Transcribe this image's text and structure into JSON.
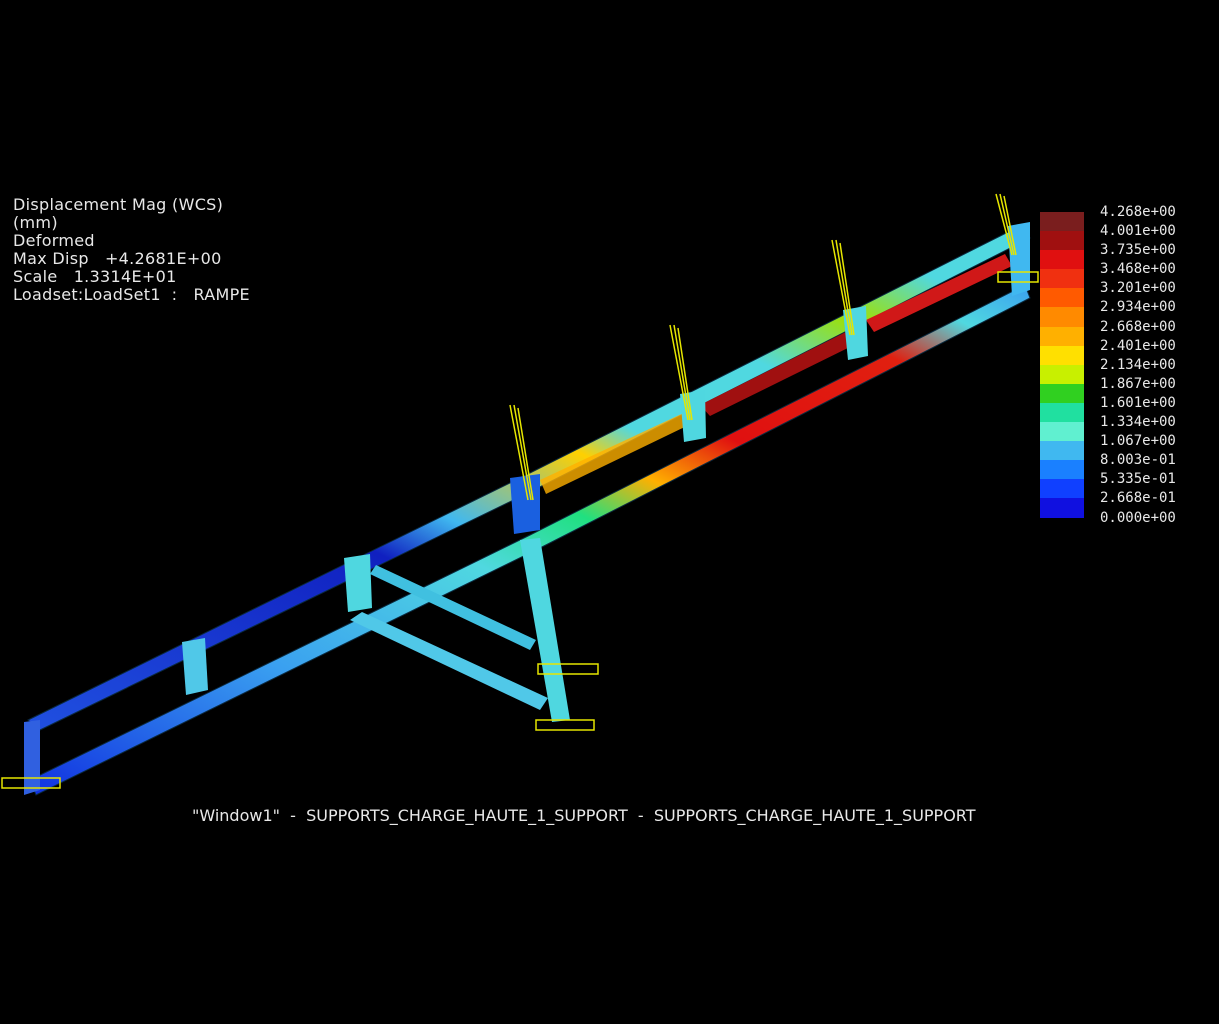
{
  "info": {
    "title": "Displacement Mag (WCS)",
    "units": "(mm)",
    "state": "Deformed",
    "max_disp": "Max Disp   +4.2681E+00",
    "scale": "Scale   1.3314E+01",
    "loadset": "Loadset:LoadSet1  :   RAMPE"
  },
  "legend": {
    "labels": [
      "4.268e+00",
      "4.001e+00",
      "3.735e+00",
      "3.468e+00",
      "3.201e+00",
      "2.934e+00",
      "2.668e+00",
      "2.401e+00",
      "2.134e+00",
      "1.867e+00",
      "1.601e+00",
      "1.334e+00",
      "1.067e+00",
      "8.003e-01",
      "5.335e-01",
      "2.668e-01",
      "0.000e+00"
    ],
    "colors": [
      "#7a1e1e",
      "#a01010",
      "#e01010",
      "#f03010",
      "#ff5a00",
      "#ff8a00",
      "#ffb000",
      "#ffe000",
      "#c8f000",
      "#30d020",
      "#20e0a0",
      "#60f0d0",
      "#40b8f0",
      "#1a80ff",
      "#1040ff",
      "#1010e0"
    ]
  },
  "caption": "\"Window1\"  -  SUPPORTS_CHARGE_HAUTE_1_SUPPORT  -  SUPPORTS_CHARGE_HAUTE_1_SUPPORT",
  "colors": {
    "frame": "#4fd7e0",
    "frame_dark": "#2a7f9e",
    "hot": "#d01818",
    "support": "#e6e600"
  }
}
